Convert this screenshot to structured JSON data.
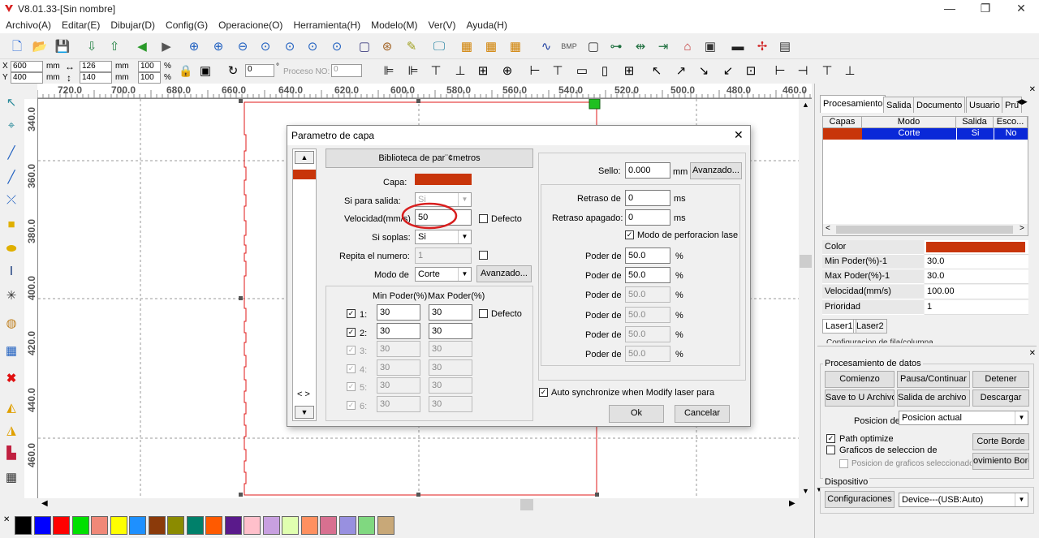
{
  "window": {
    "title": "V8.01.33-[Sin nombre]",
    "minimize": "—",
    "maximize": "❐",
    "close": "✕"
  },
  "menu": [
    "Archivo(A)",
    "Editar(E)",
    "Dibujar(D)",
    "Config(G)",
    "Operacione(O)",
    "Herramienta(H)",
    "Modelo(M)",
    "Ver(V)",
    "Ayuda(H)"
  ],
  "position_bar": {
    "x_label": "X",
    "x_value": "600",
    "y_label": "Y",
    "y_value": "400",
    "unit": "mm",
    "w_value": "126",
    "h_value": "140",
    "w_pct": "100",
    "h_pct": "100",
    "pct": "%",
    "rotation": "0",
    "degree": "°",
    "proceso_label": "Proceso NO:",
    "proceso_value": "0"
  },
  "ruler_h": [
    "720.0",
    "700.0",
    "680.0",
    "660.0",
    "640.0",
    "620.0",
    "600.0",
    "580.0",
    "560.0",
    "540.0",
    "520.0",
    "500.0",
    "480.0",
    "460.0"
  ],
  "ruler_v": [
    "340.0",
    "360.0",
    "380.0",
    "400.0",
    "420.0",
    "440.0",
    "460.0"
  ],
  "right_panel": {
    "tabs": [
      "Procesamiento",
      "Salida",
      "Documento",
      "Usuario",
      "Pru"
    ],
    "layers_table": {
      "headers": [
        "Capas",
        "Modo",
        "Salida",
        "Esco..."
      ],
      "rows": [
        {
          "color": "#c8350a",
          "mode": "Corte",
          "output": "Si",
          "hide": "No"
        }
      ]
    },
    "properties": [
      {
        "key": "Color",
        "value": ""
      },
      {
        "key": "Min Poder(%)-1",
        "value": "30.0"
      },
      {
        "key": "Max Poder(%)-1",
        "value": "30.0"
      },
      {
        "key": "Velocidad(mm/s)",
        "value": "100.00"
      },
      {
        "key": "Prioridad",
        "value": "1"
      }
    ],
    "laser_tabs": [
      "Laser1",
      "Laser2"
    ],
    "config_cut": "Configuracion de fila/columna",
    "data_title": "Procesamiento de datos",
    "buttons": {
      "start": "Comienzo",
      "pause": "Pausa/Continuar",
      "stop": "Detener",
      "save_u": "Save to U Archivo",
      "output_u": "Salida de archivo U",
      "download": "Descargar"
    },
    "position_label": "Posicion de",
    "position_value": "Posicion actual",
    "path_optimize": "Path optimize",
    "graphics_sel": "Graficos de seleccion de",
    "graphics_pos": "Posicion de graficos seleccionado",
    "corte_borde": "Corte Borde",
    "mov_borde": "ovimiento Bord",
    "device_title": "Dispositivo",
    "config_btn": "Configuraciones",
    "device_value": "Device---(USB:Auto)"
  },
  "dialog": {
    "title": "Parametro de capa",
    "close": "✕",
    "library_btn": "Biblioteca de par¨¢metros",
    "capa_label": "Capa:",
    "capa_color": "#c8350a",
    "output_label": "Si para salida:",
    "output_value": "Si",
    "speed_label": "Velocidad(mm/s)",
    "speed_value": "50",
    "default_label": "Defecto",
    "blow_label": "Si soplas:",
    "blow_value": "Si",
    "repeat_label": "Repita el numero:",
    "repeat_value": "1",
    "mode_label": "Modo de",
    "mode_value": "Corte",
    "advanced_btn": "Avanzado...",
    "min_header": "Min Poder(%)",
    "max_header": "Max Poder(%)",
    "powers": [
      {
        "label": "1:",
        "min": "30",
        "max": "30",
        "enabled": true
      },
      {
        "label": "2:",
        "min": "30",
        "max": "30",
        "enabled": true
      },
      {
        "label": "3:",
        "min": "30",
        "max": "30",
        "enabled": false
      },
      {
        "label": "4:",
        "min": "30",
        "max": "30",
        "enabled": false
      },
      {
        "label": "5:",
        "min": "30",
        "max": "30",
        "enabled": false
      },
      {
        "label": "6:",
        "min": "30",
        "max": "30",
        "enabled": false
      }
    ],
    "default2": "Defecto",
    "seal_label": "Sello:",
    "seal_value": "0.000",
    "seal_unit": "mm",
    "seal_adv": "Avanzado...",
    "delay_on_label": "Retraso de",
    "delay_on": "0",
    "delay_off_label": "Retraso apagado:",
    "delay_off": "0",
    "ms": "ms",
    "perforation": "Modo de perforacion lase",
    "power_label": "Poder de",
    "power_values": [
      "50.0",
      "50.0",
      "50.0",
      "50.0",
      "50.0",
      "50.0"
    ],
    "pct": "%",
    "auto_sync": "Auto synchronize when Modify laser para",
    "ok": "Ok",
    "cancel": "Cancelar",
    "nav": "< >"
  },
  "palette": [
    "#000000",
    "#0000ff",
    "#ff0000",
    "#00e000",
    "#f08878",
    "#ffff00",
    "#1e90ff",
    "#8b3a0a",
    "#8b8b00",
    "#00806a",
    "#ff5a00",
    "#5a1a8b",
    "#ffc0cb",
    "#c8a0e0",
    "#e0ffb0",
    "#ff9060",
    "#d87090",
    "#9890e0",
    "#80d880",
    "#c8a878"
  ],
  "colors": {
    "accent_red": "#d81e1e",
    "selection_blue": "#0a28d8"
  }
}
